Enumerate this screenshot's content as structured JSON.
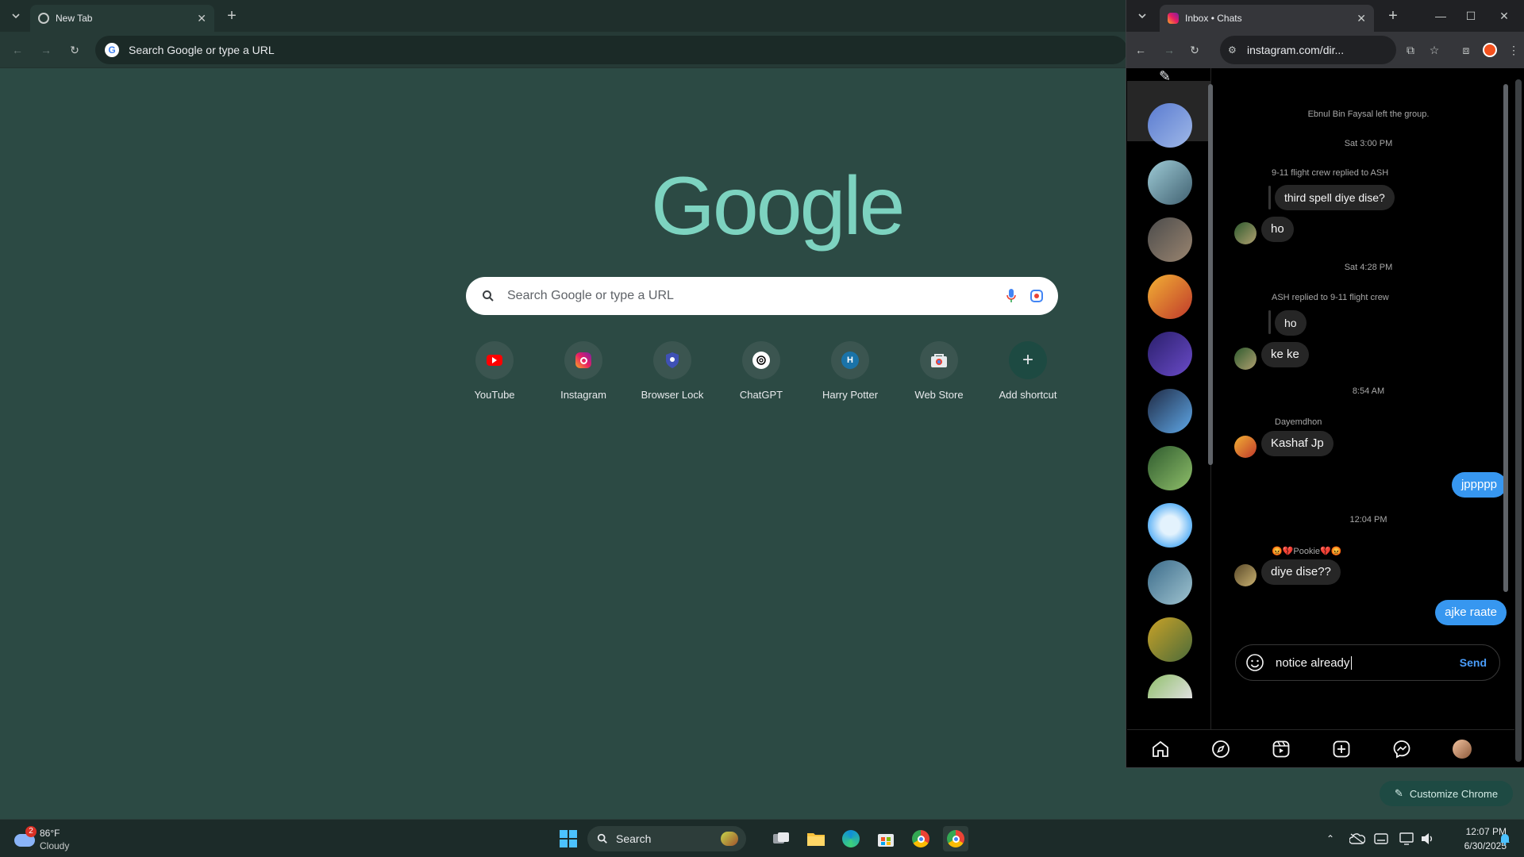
{
  "left_window": {
    "tab": {
      "title": "New Tab"
    },
    "omnibox": {
      "placeholder": "Search Google or type a URL"
    },
    "logo": "Google",
    "search": {
      "placeholder": "Search Google or type a URL"
    },
    "shortcuts": [
      {
        "label": "YouTube",
        "icon": "youtube-icon"
      },
      {
        "label": "Instagram",
        "icon": "instagram-icon"
      },
      {
        "label": "Browser Lock",
        "icon": "shield-icon"
      },
      {
        "label": "ChatGPT",
        "icon": "chatgpt-icon"
      },
      {
        "label": "Harry Potter",
        "icon": "letter-h-icon",
        "letter": "H"
      },
      {
        "label": "Web Store",
        "icon": "webstore-icon"
      },
      {
        "label": "Add shortcut",
        "icon": "plus-icon"
      }
    ],
    "customize": "Customize Chrome"
  },
  "right_window": {
    "tab": {
      "title": "Inbox • Chats"
    },
    "url": "instagram.com/dir...",
    "messages": {
      "left_group": "Ebnul Bin Faysal left the group.",
      "time1": "Sat 3:00 PM",
      "reply1_label": "9-11 flight crew replied to ASH",
      "reply1_quote": "third spell diye dise?",
      "reply1_msg": "ho",
      "time2": "Sat 4:28 PM",
      "reply2_label": "ASH replied to 9-11 flight crew",
      "reply2_quote": "ho",
      "reply2_msg": "ke ke",
      "time3": "8:54 AM",
      "sender3": "Dayemdhon",
      "msg3": "Kashaf Jp",
      "me1": "jppppp",
      "time4": "12:04 PM",
      "sender4": "😡💔Pookie💔😡",
      "msg4": "diye dise??",
      "me2": "ajke raate"
    },
    "composer": {
      "value": "notice already",
      "send": "Send"
    }
  },
  "taskbar": {
    "weather_temp": "86°F",
    "weather_desc": "Cloudy",
    "weather_badge": "2",
    "search": "Search",
    "time": "12:07 PM",
    "date": "6/30/2025"
  },
  "colors": {
    "ntp_bg": "#2c4a44",
    "accent": "#7dd3c0",
    "ig_blue": "#3797f0"
  }
}
